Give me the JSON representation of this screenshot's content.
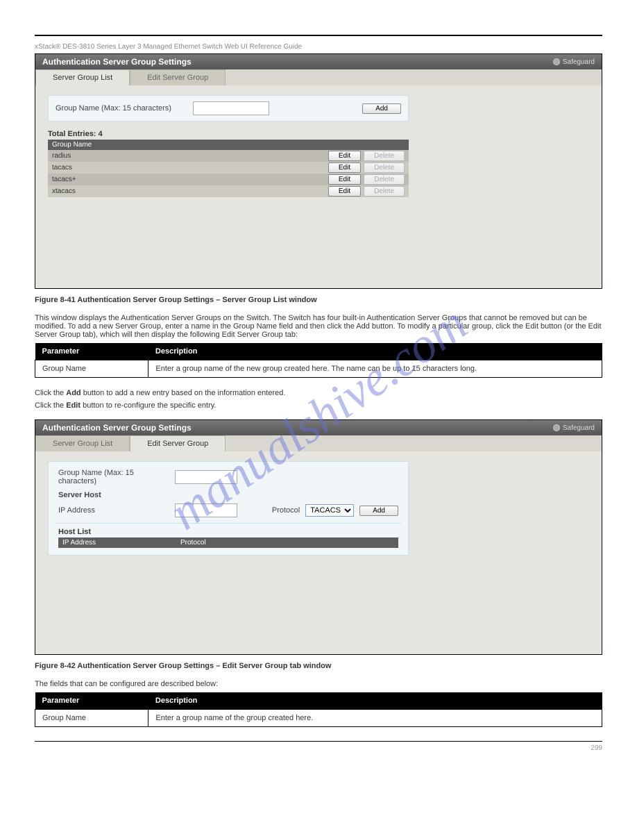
{
  "doc_header": "xStack® DES-3810 Series Layer 3 Managed Ethernet Switch Web UI Reference Guide",
  "watermark": "manualshive.com",
  "panel1": {
    "title": "Authentication Server Group Settings",
    "badge": "Safeguard",
    "tab_list": "Server Group List",
    "tab_edit": "Edit Server Group",
    "group_name_label": "Group Name  (Max: 15 characters)",
    "add_label": "Add",
    "total_entries_label": "Total Entries:",
    "total_entries_value": "4",
    "header_group_name": "Group Name",
    "rows": [
      {
        "name": "radius",
        "edit": "Edit",
        "del": "Delete"
      },
      {
        "name": "tacacs",
        "edit": "Edit",
        "del": "Delete"
      },
      {
        "name": "tacacs+",
        "edit": "Edit",
        "del": "Delete"
      },
      {
        "name": "xtacacs",
        "edit": "Edit",
        "del": "Delete"
      }
    ]
  },
  "figure1": {
    "caption_left": "Figure 8-41 Authentication Server Group Settings – Server Group List window"
  },
  "text_block1": "This window displays the Authentication Server Groups on the Switch. The Switch has four built-in Authentication Server Groups that cannot be removed but can be modified. To add a new Server Group, enter a name in the Group Name field and then click the Add button. To modify a particular group, click the Edit button (or the Edit Server Group tab), which will then display the following Edit Server Group tab:",
  "params1": {
    "header_param": "Parameter",
    "header_desc": "Description",
    "row_param": "Group Name",
    "row_desc": "Enter a group name of the new group created here. The name can be up to 15 characters long."
  },
  "instr1_prefix": "Click the ",
  "instr1_bold": "Add",
  "instr1_suffix": " button to add a new entry based on the information entered.",
  "instr2_prefix": "Click the ",
  "instr2_bold": "Edit",
  "instr2_suffix": " button to re-configure the specific entry.",
  "panel2": {
    "title": "Authentication Server Group Settings",
    "badge": "Safeguard",
    "tab_list": "Server Group List",
    "tab_edit": "Edit Server Group",
    "group_name_label": "Group Name  (Max: 15 characters)",
    "server_host_label": "Server Host",
    "ip_address_label": "IP Address",
    "protocol_label": "Protocol",
    "protocol_value": "TACACS",
    "add_label": "Add",
    "host_list_label": "Host List",
    "host_col_ip": "IP Address",
    "host_col_proto": "Protocol"
  },
  "figure2": {
    "caption_left": "Figure 8-42 Authentication Server Group Settings – Edit Server Group tab window"
  },
  "text_block2": "The fields that can be configured are described below:",
  "params2": {
    "header_param": "Parameter",
    "header_desc": "Description",
    "row_param": "Group Name",
    "row_desc": "Enter a group name of the group created here."
  },
  "footer": {
    "left": "",
    "page": "299"
  }
}
